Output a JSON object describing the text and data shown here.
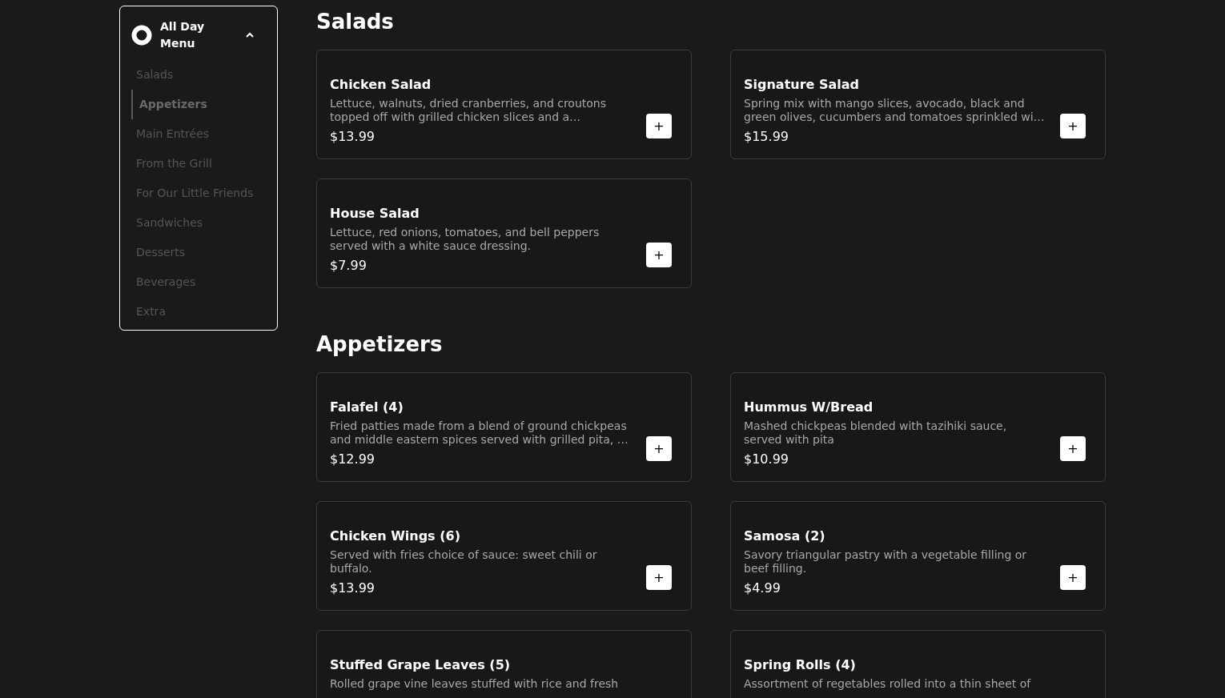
{
  "sidebar": {
    "title": "All Day Menu",
    "expanded": true,
    "items": [
      {
        "label": "Salads",
        "selected": false
      },
      {
        "label": "Appetizers",
        "selected": true
      },
      {
        "label": "Main Entrées",
        "selected": false
      },
      {
        "label": "From the Grill",
        "selected": false
      },
      {
        "label": "For Our Little Friends",
        "selected": false
      },
      {
        "label": "Sandwiches",
        "selected": false
      },
      {
        "label": "Desserts",
        "selected": false
      },
      {
        "label": "Beverages",
        "selected": false
      },
      {
        "label": "Extra",
        "selected": false
      }
    ]
  },
  "sections": [
    {
      "title": "Salads",
      "items": [
        {
          "name": "Chicken Salad",
          "description": "Lettuce, walnuts, dried cranberries, and croutons topped off with grilled chicken slices and a…",
          "price": "$13.99",
          "add": "+"
        },
        {
          "name": "Signature Salad",
          "description": "Spring mix with mango slices, avocado, black and green olives, cucumbers and tomatoes sprinkled wi…",
          "price": "$15.99",
          "add": "+"
        },
        {
          "name": "House Salad",
          "description": "Lettuce, red onions, tomatoes, and bell peppers served with a white sauce dressing.",
          "price": "$7.99",
          "add": "+"
        }
      ]
    },
    {
      "title": "Appetizers",
      "items": [
        {
          "name": "Falafel (4)",
          "description": "Fried patties made from a blend of ground chickpeas and middle eastern spices served with grilled pita, …",
          "price": "$12.99",
          "add": "+"
        },
        {
          "name": "Hummus W/Bread",
          "description": "Mashed chickpeas blended with tazihiki sauce, served with pita",
          "price": "$10.99",
          "add": "+"
        },
        {
          "name": "Chicken Wings (6)",
          "description": "Served with fries choice of sauce: sweet chili or buffalo.",
          "price": "$13.99",
          "add": "+"
        },
        {
          "name": "Samosa (2)",
          "description": "Savory triangular pastry with a vegetable filling or beef filling.",
          "price": "$4.99",
          "add": "+"
        },
        {
          "name": "Stuffed Grape Leaves (5)",
          "description": "Rolled grape vine leaves stuffed with rice and fresh"
        },
        {
          "name": "Spring Rolls (4)",
          "description": "Assortment of regetables rolled into a thin sheet of"
        }
      ]
    }
  ]
}
